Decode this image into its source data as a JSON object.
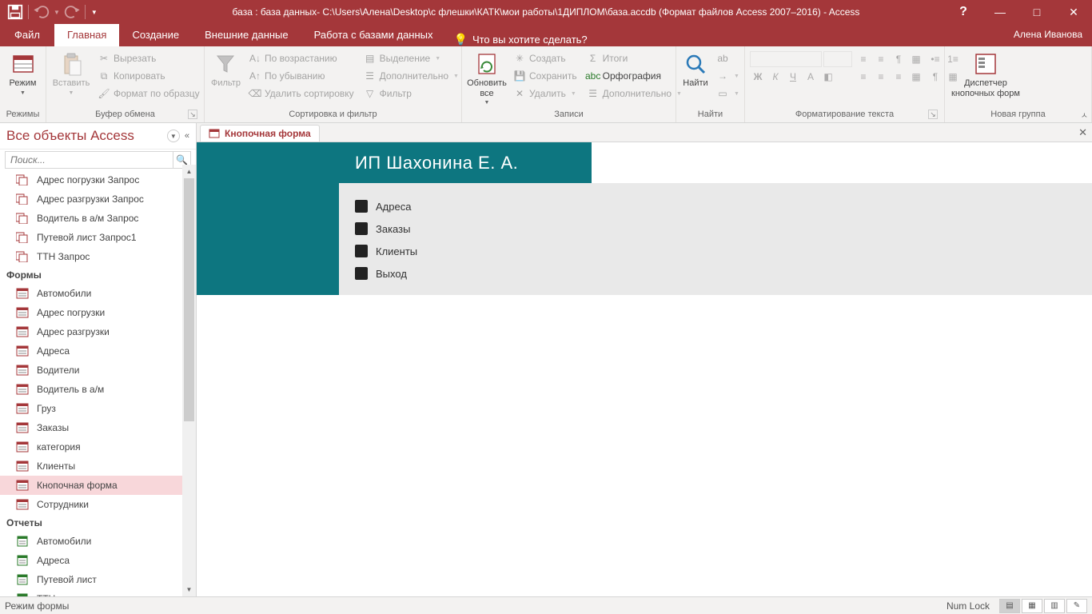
{
  "titlebar": {
    "title": "база : база данных- C:\\Users\\Алена\\Desktop\\с флешки\\КАТК\\мои работы\\1ДИПЛОМ\\база.accdb (Формат файлов Access 2007–2016) - Access"
  },
  "tabs": {
    "file": "Файл",
    "home": "Главная",
    "create": "Создание",
    "external": "Внешние данные",
    "dbtools": "Работа с базами данных",
    "tellme": "Что вы хотите сделать?",
    "user": "Алена Иванова"
  },
  "ribbon": {
    "views": {
      "mode": "Режим",
      "group": "Режимы"
    },
    "clipboard": {
      "paste": "Вставить",
      "cut": "Вырезать",
      "copy": "Копировать",
      "formatPainter": "Формат по образцу",
      "group": "Буфер обмена"
    },
    "sortfilter": {
      "filter": "Фильтр",
      "asc": "По возрастанию",
      "desc": "По убыванию",
      "clear": "Удалить сортировку",
      "selection": "Выделение",
      "advanced": "Дополнительно",
      "toggle": "Фильтр",
      "group": "Сортировка и фильтр"
    },
    "records": {
      "refresh": "Обновить все",
      "new": "Создать",
      "save": "Сохранить",
      "delete": "Удалить",
      "totals": "Итоги",
      "spelling": "Орфография",
      "more": "Дополнительно",
      "group": "Записи"
    },
    "find": {
      "find": "Найти",
      "group": "Найти"
    },
    "textfmt": {
      "group": "Форматирование текста"
    },
    "custom": {
      "btn": "Диспетчер кнопочных форм",
      "group": "Новая группа"
    }
  },
  "nav": {
    "title": "Все объекты Access",
    "searchPlaceholder": "Поиск...",
    "queries": [
      "Адрес погрузки Запрос",
      "Адрес разгрузки Запрос",
      "Водитель в а/м Запрос",
      "Путевой лист Запрос1",
      "ТТН Запрос"
    ],
    "formsHeader": "Формы",
    "forms": [
      "Автомобили",
      "Адрес погрузки",
      "Адрес разгрузки",
      "Адреса",
      "Водители",
      "Водитель в а/м",
      "Груз",
      "Заказы",
      "категория",
      "Клиенты",
      "Кнопочная форма",
      "Сотрудники"
    ],
    "reportsHeader": "Отчеты",
    "reports": [
      "Автомобили",
      "Адреса",
      "Путевой лист",
      "ТТН"
    ]
  },
  "doc": {
    "tab": "Кнопочная форма",
    "bannerTitle": "ИП Шахонина Е. А.",
    "buttons": [
      "Адреса",
      "Заказы",
      "Клиенты",
      "Выход"
    ]
  },
  "status": {
    "mode": "Режим формы",
    "numlock": "Num Lock"
  }
}
